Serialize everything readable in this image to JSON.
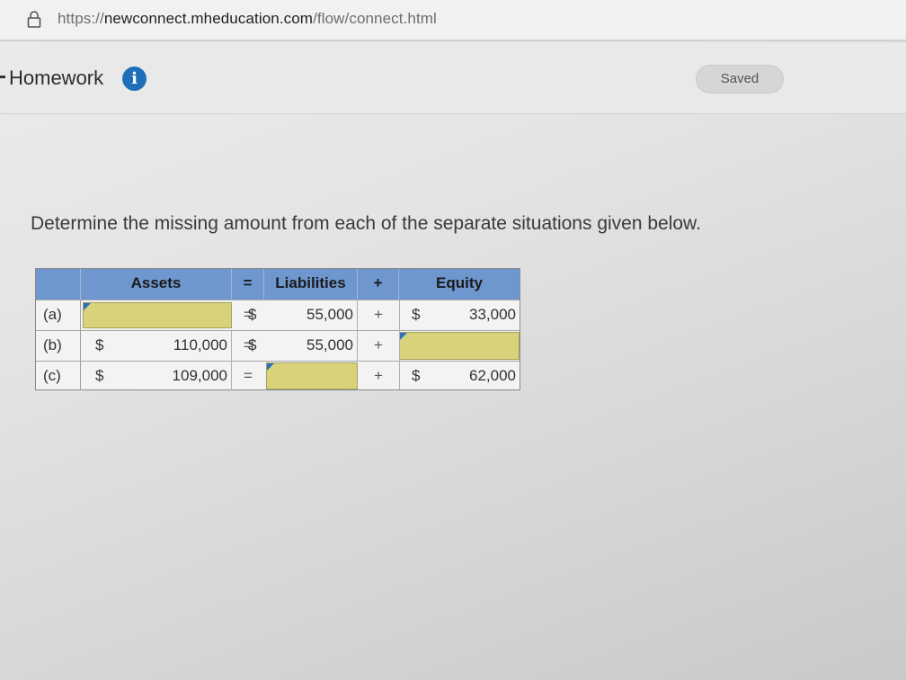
{
  "browser": {
    "url_scheme": "https://",
    "url_host": "newconnect.mheducation.com",
    "url_path": "/flow/connect.html"
  },
  "header": {
    "title": "Homework",
    "info_icon": "i",
    "saved_label": "Saved"
  },
  "question": {
    "prompt": "Determine the missing amount from each of the separate situations given below."
  },
  "table": {
    "headers": {
      "assets": "Assets",
      "equals": "=",
      "liabilities": "Liabilities",
      "plus": "+",
      "equity": "Equity"
    },
    "rows": [
      {
        "label": "(a)",
        "assets_dollar": "",
        "assets": "",
        "equals": "=",
        "liab_dollar": "$",
        "liabilities": "55,000",
        "plus": "+",
        "equity_dollar": "$",
        "equity": "33,000"
      },
      {
        "label": "(b)",
        "assets_dollar": "$",
        "assets": "110,000",
        "equals": "=",
        "liab_dollar": "$",
        "liabilities": "55,000",
        "plus": "+",
        "equity_dollar": "",
        "equity": ""
      },
      {
        "label": "(c)",
        "assets_dollar": "$",
        "assets": "109,000",
        "equals": "=",
        "liab_dollar": "",
        "liabilities": "",
        "plus": "+",
        "equity_dollar": "$",
        "equity": "62,000"
      }
    ]
  },
  "colors": {
    "header_blue": "#6f97cf",
    "input_yellow": "#d8d27a",
    "info_blue": "#1f6fb8"
  }
}
